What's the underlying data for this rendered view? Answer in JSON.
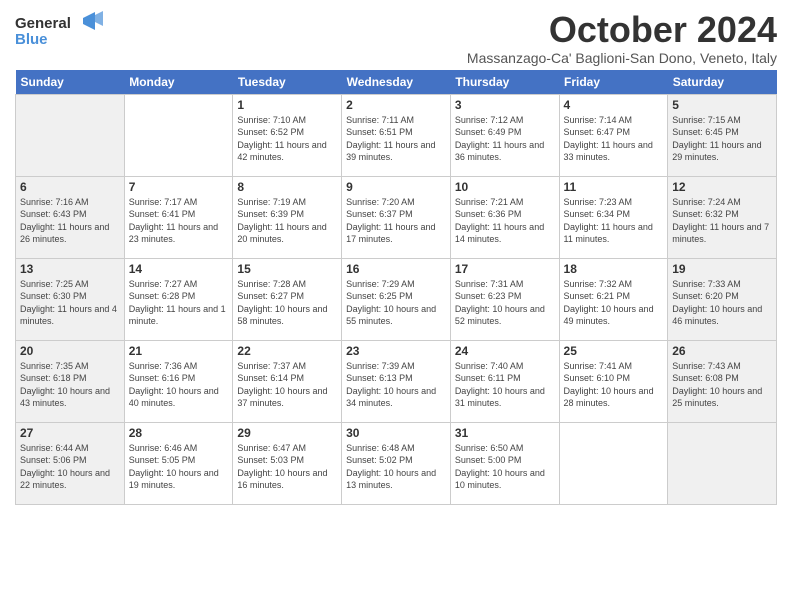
{
  "header": {
    "logo_line1": "General",
    "logo_line2": "Blue",
    "month": "October 2024",
    "location": "Massanzago-Ca' Baglioni-San Dono, Veneto, Italy"
  },
  "days_of_week": [
    "Sunday",
    "Monday",
    "Tuesday",
    "Wednesday",
    "Thursday",
    "Friday",
    "Saturday"
  ],
  "weeks": [
    [
      {
        "day": "",
        "info": ""
      },
      {
        "day": "",
        "info": ""
      },
      {
        "day": "1",
        "info": "Sunrise: 7:10 AM\nSunset: 6:52 PM\nDaylight: 11 hours and 42 minutes."
      },
      {
        "day": "2",
        "info": "Sunrise: 7:11 AM\nSunset: 6:51 PM\nDaylight: 11 hours and 39 minutes."
      },
      {
        "day": "3",
        "info": "Sunrise: 7:12 AM\nSunset: 6:49 PM\nDaylight: 11 hours and 36 minutes."
      },
      {
        "day": "4",
        "info": "Sunrise: 7:14 AM\nSunset: 6:47 PM\nDaylight: 11 hours and 33 minutes."
      },
      {
        "day": "5",
        "info": "Sunrise: 7:15 AM\nSunset: 6:45 PM\nDaylight: 11 hours and 29 minutes."
      }
    ],
    [
      {
        "day": "6",
        "info": "Sunrise: 7:16 AM\nSunset: 6:43 PM\nDaylight: 11 hours and 26 minutes."
      },
      {
        "day": "7",
        "info": "Sunrise: 7:17 AM\nSunset: 6:41 PM\nDaylight: 11 hours and 23 minutes."
      },
      {
        "day": "8",
        "info": "Sunrise: 7:19 AM\nSunset: 6:39 PM\nDaylight: 11 hours and 20 minutes."
      },
      {
        "day": "9",
        "info": "Sunrise: 7:20 AM\nSunset: 6:37 PM\nDaylight: 11 hours and 17 minutes."
      },
      {
        "day": "10",
        "info": "Sunrise: 7:21 AM\nSunset: 6:36 PM\nDaylight: 11 hours and 14 minutes."
      },
      {
        "day": "11",
        "info": "Sunrise: 7:23 AM\nSunset: 6:34 PM\nDaylight: 11 hours and 11 minutes."
      },
      {
        "day": "12",
        "info": "Sunrise: 7:24 AM\nSunset: 6:32 PM\nDaylight: 11 hours and 7 minutes."
      }
    ],
    [
      {
        "day": "13",
        "info": "Sunrise: 7:25 AM\nSunset: 6:30 PM\nDaylight: 11 hours and 4 minutes."
      },
      {
        "day": "14",
        "info": "Sunrise: 7:27 AM\nSunset: 6:28 PM\nDaylight: 11 hours and 1 minute."
      },
      {
        "day": "15",
        "info": "Sunrise: 7:28 AM\nSunset: 6:27 PM\nDaylight: 10 hours and 58 minutes."
      },
      {
        "day": "16",
        "info": "Sunrise: 7:29 AM\nSunset: 6:25 PM\nDaylight: 10 hours and 55 minutes."
      },
      {
        "day": "17",
        "info": "Sunrise: 7:31 AM\nSunset: 6:23 PM\nDaylight: 10 hours and 52 minutes."
      },
      {
        "day": "18",
        "info": "Sunrise: 7:32 AM\nSunset: 6:21 PM\nDaylight: 10 hours and 49 minutes."
      },
      {
        "day": "19",
        "info": "Sunrise: 7:33 AM\nSunset: 6:20 PM\nDaylight: 10 hours and 46 minutes."
      }
    ],
    [
      {
        "day": "20",
        "info": "Sunrise: 7:35 AM\nSunset: 6:18 PM\nDaylight: 10 hours and 43 minutes."
      },
      {
        "day": "21",
        "info": "Sunrise: 7:36 AM\nSunset: 6:16 PM\nDaylight: 10 hours and 40 minutes."
      },
      {
        "day": "22",
        "info": "Sunrise: 7:37 AM\nSunset: 6:14 PM\nDaylight: 10 hours and 37 minutes."
      },
      {
        "day": "23",
        "info": "Sunrise: 7:39 AM\nSunset: 6:13 PM\nDaylight: 10 hours and 34 minutes."
      },
      {
        "day": "24",
        "info": "Sunrise: 7:40 AM\nSunset: 6:11 PM\nDaylight: 10 hours and 31 minutes."
      },
      {
        "day": "25",
        "info": "Sunrise: 7:41 AM\nSunset: 6:10 PM\nDaylight: 10 hours and 28 minutes."
      },
      {
        "day": "26",
        "info": "Sunrise: 7:43 AM\nSunset: 6:08 PM\nDaylight: 10 hours and 25 minutes."
      }
    ],
    [
      {
        "day": "27",
        "info": "Sunrise: 6:44 AM\nSunset: 5:06 PM\nDaylight: 10 hours and 22 minutes."
      },
      {
        "day": "28",
        "info": "Sunrise: 6:46 AM\nSunset: 5:05 PM\nDaylight: 10 hours and 19 minutes."
      },
      {
        "day": "29",
        "info": "Sunrise: 6:47 AM\nSunset: 5:03 PM\nDaylight: 10 hours and 16 minutes."
      },
      {
        "day": "30",
        "info": "Sunrise: 6:48 AM\nSunset: 5:02 PM\nDaylight: 10 hours and 13 minutes."
      },
      {
        "day": "31",
        "info": "Sunrise: 6:50 AM\nSunset: 5:00 PM\nDaylight: 10 hours and 10 minutes."
      },
      {
        "day": "",
        "info": ""
      },
      {
        "day": "",
        "info": ""
      }
    ]
  ]
}
